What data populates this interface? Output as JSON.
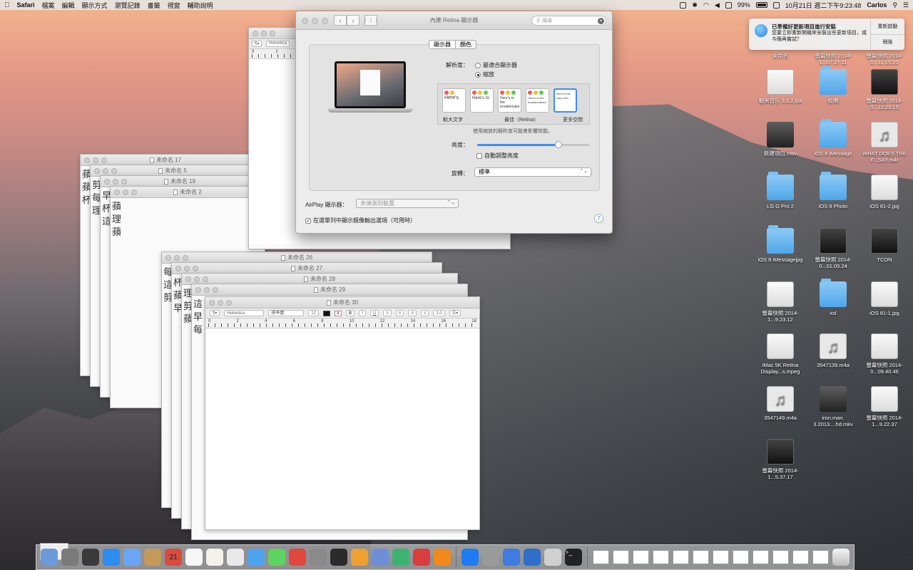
{
  "menubar": {
    "app": "Safari",
    "menus": [
      "檔案",
      "編輯",
      "顯示方式",
      "瀏覽記錄",
      "書籤",
      "視窗",
      "輔助說明"
    ],
    "battery": "99%",
    "datetime": "10月21日 週二下午9:23:48",
    "user": "Carlos"
  },
  "notification": {
    "title": "已準備好更新項目進行安裝",
    "body": "您要立即重新開機來安裝這些更新項目，或今晚再嘗試？",
    "restart": "重新啟動",
    "later": "稍後"
  },
  "stack_windows": [
    "未命名 17",
    "未命名 5",
    "未命名 19",
    "未命名 2",
    "未命名 26",
    "未命名 27",
    "未命名 28",
    "未命名 29",
    "未命名 30"
  ],
  "front_window": {
    "font": "Helvetica",
    "style": "標準體",
    "size": "12",
    "spacing": "1.0",
    "ruler": [
      "0",
      "2",
      "4",
      "6",
      "8",
      "10",
      "12",
      "14",
      "16",
      "18"
    ]
  },
  "back_window": {
    "font": "Helvetica",
    "ruler": [
      "0",
      "2"
    ]
  },
  "prefs": {
    "title": "內建 Retina 顯示器",
    "search_placeholder": "搜尋",
    "tabs": [
      "顯示器",
      "顏色"
    ],
    "resolution_label": "解析度：",
    "opt_best": "最適合顯示器",
    "opt_scaled": "縮放",
    "scale_labels": [
      "較大文字",
      "最佳（Retina）",
      "更多空間"
    ],
    "scale_samples": [
      "Here's",
      "Here's to",
      "Here's to the troublemake",
      "Here's to the troublemakers.",
      "Here's to the crazy ones."
    ],
    "scale_note": "使用縮放的解析度可能會影響效能。",
    "brightness_label": "亮度：",
    "brightness_level": 0.72,
    "auto_brightness": "自動調整亮度",
    "rotation_label": "旋轉：",
    "rotation_value": "標準",
    "airplay_label": "AirPlay 顯示器：",
    "airplay_value": "未偵測到裝置",
    "mirror_option": "在選單列中顯示鏡像輸出選項（可用時）"
  },
  "desktop_icons": [
    {
      "name": "未命名",
      "kind": "shot"
    },
    {
      "name": "螢幕快照 2014-1...07.27.11",
      "kind": "shot"
    },
    {
      "name": "螢幕快照 2014-0...11.15.20",
      "kind": "shot"
    },
    {
      "name": "蝦米音乐 3.1.2.ipa",
      "kind": "shot"
    },
    {
      "name": "校網",
      "kind": "folder"
    },
    {
      "name": "螢幕快照 2014-0...12.20.15",
      "kind": "dark"
    },
    {
      "name": "新建項目.mov",
      "kind": "video"
    },
    {
      "name": "iOS 8 iMessage",
      "kind": "folder"
    },
    {
      "name": "WHAT DOES THE F...SAY.m4r",
      "kind": "audio"
    },
    {
      "name": "LG G Pro 2",
      "kind": "folder"
    },
    {
      "name": "iOS 8 Photo",
      "kind": "folder"
    },
    {
      "name": "iOS 81-2.jpg",
      "kind": "shot"
    },
    {
      "name": "iOS 8 iMessagejpg",
      "kind": "folder"
    },
    {
      "name": "螢幕快照 2014-0...01.05.24",
      "kind": "dark"
    },
    {
      "name": "TCON",
      "kind": "dark"
    },
    {
      "name": "螢幕快照 2014-1...9.23.12",
      "kind": "shot"
    },
    {
      "name": "xsl",
      "kind": "folder"
    },
    {
      "name": "iOS 81-1.jpg",
      "kind": "shot"
    },
    {
      "name": "iMac 5K Retina Display...s.mpeg",
      "kind": "shot"
    },
    {
      "name": "3547139.m4a",
      "kind": "audio"
    },
    {
      "name": "螢幕快照 2014-0...09.40.46",
      "kind": "shot"
    },
    {
      "name": "3547149.m4a",
      "kind": "audio"
    },
    {
      "name": "iron.man. 3.2013....hd.mkv",
      "kind": "video"
    },
    {
      "name": "螢幕快照 2014-1...9.22.37",
      "kind": "shot"
    },
    {
      "name": "螢幕快照 2014-1...5.37.17",
      "kind": "dark"
    }
  ],
  "dock": {
    "calendar_day": "21",
    "colors": [
      "#6b9bd8",
      "#7a7a7a",
      "#3a3a3a",
      "#2d8cf0",
      "#6aa6f5",
      "#c49a5a",
      "#d84c3c",
      "#f7f7f7",
      "#f3f1ea",
      "#e9e9e9",
      "#4ea3f0",
      "#5fd35f",
      "#e0473e",
      "#8a8a8a",
      "#2b2b2b",
      "#f0a030",
      "#6d8fd6",
      "#3cb371",
      "#d93d3d",
      "#f08a1d",
      "#1e7cf2",
      "#9a9a9a",
      "#3f7be0",
      "#2f6ec9",
      "#d0d0d0",
      "#222222"
    ]
  }
}
